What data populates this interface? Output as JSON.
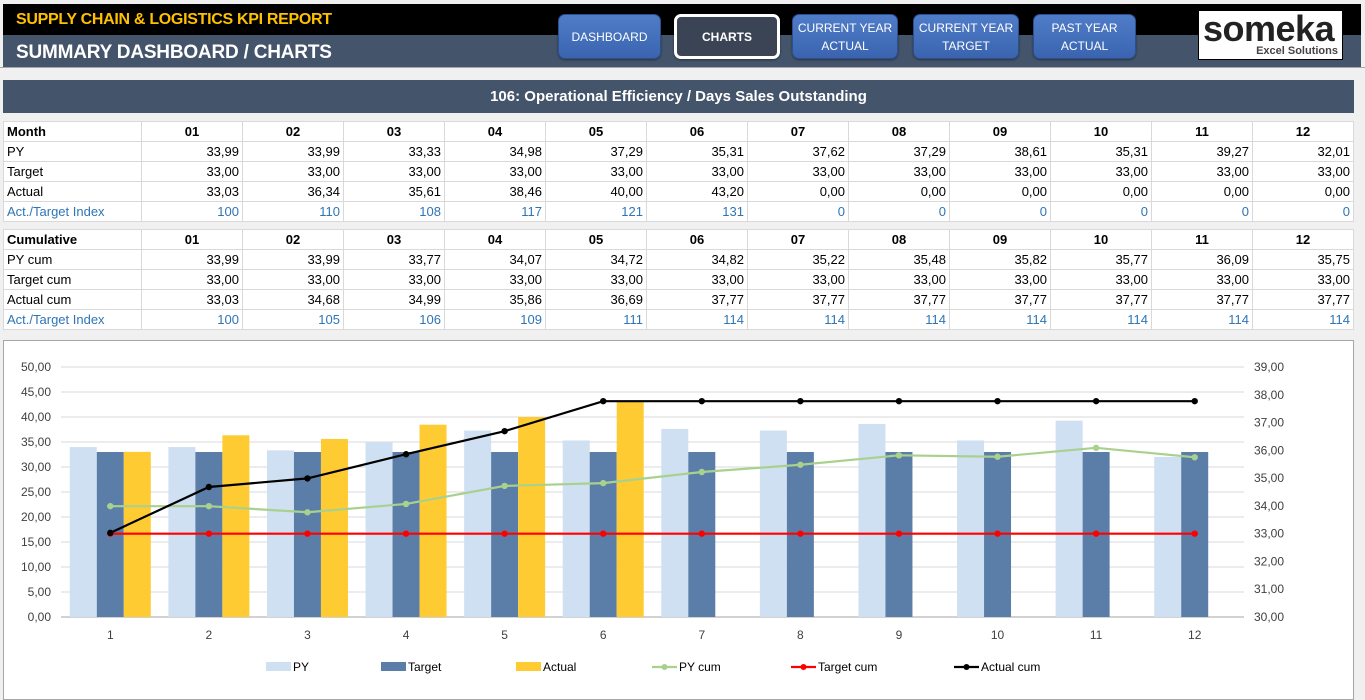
{
  "header": {
    "report_title": "SUPPLY CHAIN & LOGISTICS KPI REPORT",
    "page_title": "SUMMARY DASHBOARD / CHARTS"
  },
  "nav": [
    {
      "label": "DASHBOARD",
      "active": false
    },
    {
      "label": "CHARTS",
      "active": true
    },
    {
      "label": "CURRENT YEAR ACTUAL",
      "active": false
    },
    {
      "label": "CURRENT YEAR TARGET",
      "active": false
    },
    {
      "label": "PAST YEAR ACTUAL",
      "active": false
    }
  ],
  "logo": {
    "main": "someka",
    "sub": "Excel Solutions"
  },
  "kpi_title": "106: Operational Efficiency / Days Sales Outstanding",
  "monthly_table": {
    "header_label": "Month",
    "months": [
      "01",
      "02",
      "03",
      "04",
      "05",
      "06",
      "07",
      "08",
      "09",
      "10",
      "11",
      "12"
    ],
    "rows": [
      {
        "label": "PY",
        "values": [
          "33,99",
          "33,99",
          "33,33",
          "34,98",
          "37,29",
          "35,31",
          "37,62",
          "37,29",
          "38,61",
          "35,31",
          "39,27",
          "32,01"
        ]
      },
      {
        "label": "Target",
        "values": [
          "33,00",
          "33,00",
          "33,00",
          "33,00",
          "33,00",
          "33,00",
          "33,00",
          "33,00",
          "33,00",
          "33,00",
          "33,00",
          "33,00"
        ]
      },
      {
        "label": "Actual",
        "values": [
          "33,03",
          "36,34",
          "35,61",
          "38,46",
          "40,00",
          "43,20",
          "0,00",
          "0,00",
          "0,00",
          "0,00",
          "0,00",
          "0,00"
        ]
      },
      {
        "label": "Act./Target Index",
        "values": [
          "100",
          "110",
          "108",
          "117",
          "121",
          "131",
          "0",
          "0",
          "0",
          "0",
          "0",
          "0"
        ],
        "is_index": true
      }
    ]
  },
  "cumulative_table": {
    "header_label": "Cumulative",
    "months": [
      "01",
      "02",
      "03",
      "04",
      "05",
      "06",
      "07",
      "08",
      "09",
      "10",
      "11",
      "12"
    ],
    "rows": [
      {
        "label": "PY cum",
        "values": [
          "33,99",
          "33,99",
          "33,77",
          "34,07",
          "34,72",
          "34,82",
          "35,22",
          "35,48",
          "35,82",
          "35,77",
          "36,09",
          "35,75"
        ]
      },
      {
        "label": "Target cum",
        "values": [
          "33,00",
          "33,00",
          "33,00",
          "33,00",
          "33,00",
          "33,00",
          "33,00",
          "33,00",
          "33,00",
          "33,00",
          "33,00",
          "33,00"
        ]
      },
      {
        "label": "Actual cum",
        "values": [
          "33,03",
          "34,68",
          "34,99",
          "35,86",
          "36,69",
          "37,77",
          "37,77",
          "37,77",
          "37,77",
          "37,77",
          "37,77",
          "37,77"
        ]
      },
      {
        "label": "Act./Target Index",
        "values": [
          "100",
          "105",
          "106",
          "109",
          "111",
          "114",
          "114",
          "114",
          "114",
          "114",
          "114",
          "114"
        ],
        "is_index": true
      }
    ]
  },
  "chart_data": {
    "type": "bar",
    "title": "",
    "xlabel": "",
    "ylabel": "",
    "categories": [
      "1",
      "2",
      "3",
      "4",
      "5",
      "6",
      "7",
      "8",
      "9",
      "10",
      "11",
      "12"
    ],
    "ylim": [
      0,
      50
    ],
    "y_ticks": [
      "0,00",
      "5,00",
      "10,00",
      "15,00",
      "20,00",
      "25,00",
      "30,00",
      "35,00",
      "40,00",
      "45,00",
      "50,00"
    ],
    "y2lim": [
      30,
      39
    ],
    "y2_ticks": [
      "30,00",
      "31,00",
      "32,00",
      "33,00",
      "34,00",
      "35,00",
      "36,00",
      "37,00",
      "38,00",
      "39,00"
    ],
    "grid": true,
    "legend_position": "bottom",
    "series": [
      {
        "name": "PY",
        "type": "bar",
        "axis": "primary",
        "color": "#cfe0f3",
        "values": [
          33.99,
          33.99,
          33.33,
          34.98,
          37.29,
          35.31,
          37.62,
          37.29,
          38.61,
          35.31,
          39.27,
          32.01
        ]
      },
      {
        "name": "Target",
        "type": "bar",
        "axis": "primary",
        "color": "#5b7ea9",
        "values": [
          33,
          33,
          33,
          33,
          33,
          33,
          33,
          33,
          33,
          33,
          33,
          33
        ]
      },
      {
        "name": "Actual",
        "type": "bar",
        "axis": "primary",
        "color": "#fecb33",
        "values": [
          33.03,
          36.34,
          35.61,
          38.46,
          40.0,
          43.2,
          0,
          0,
          0,
          0,
          0,
          0
        ]
      },
      {
        "name": "PY cum",
        "type": "line",
        "axis": "secondary",
        "color": "#a9d18e",
        "values": [
          33.99,
          33.99,
          33.77,
          34.07,
          34.72,
          34.82,
          35.22,
          35.48,
          35.82,
          35.77,
          36.09,
          35.75
        ]
      },
      {
        "name": "Target cum",
        "type": "line",
        "axis": "secondary",
        "color": "#ff0000",
        "values": [
          33,
          33,
          33,
          33,
          33,
          33,
          33,
          33,
          33,
          33,
          33,
          33
        ]
      },
      {
        "name": "Actual cum",
        "type": "line",
        "axis": "secondary",
        "color": "#000000",
        "values": [
          33.03,
          34.68,
          34.99,
          35.86,
          36.69,
          37.77,
          37.77,
          37.77,
          37.77,
          37.77,
          37.77,
          37.77
        ]
      }
    ]
  }
}
